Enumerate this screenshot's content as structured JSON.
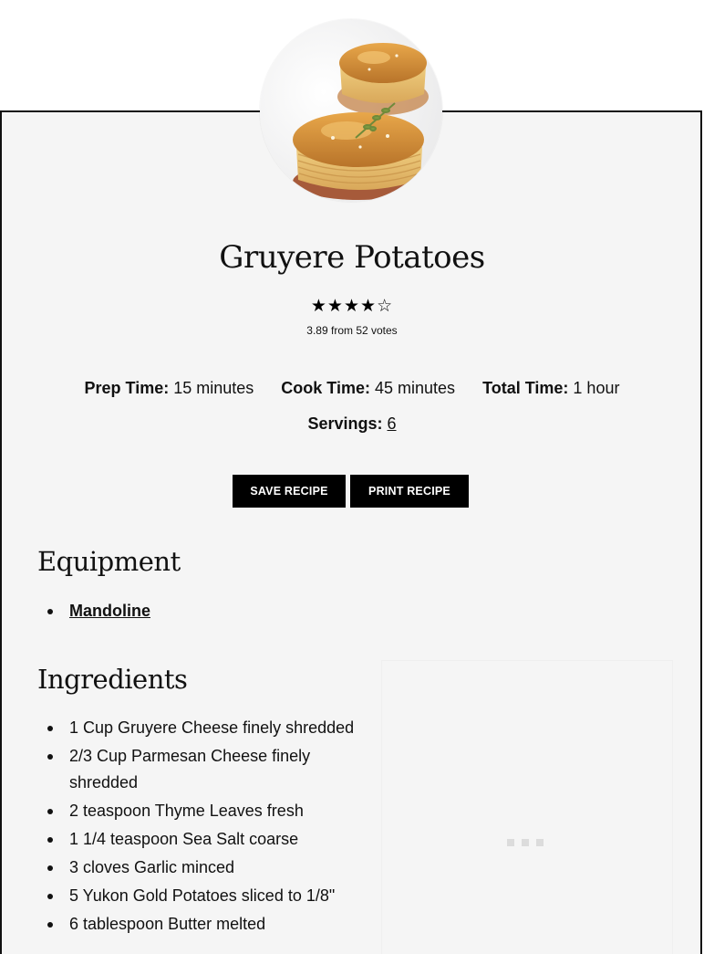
{
  "recipe": {
    "title": "Gruyere Potatoes",
    "rating": {
      "value": 3.89,
      "stars_full": 4,
      "stars_total": 5,
      "text": "3.89 from 52 votes"
    },
    "times": {
      "prep_label": "Prep Time:",
      "prep_value": "15 minutes",
      "cook_label": "Cook Time:",
      "cook_value": "45 minutes",
      "total_label": "Total Time:",
      "total_value": "1 hour"
    },
    "servings": {
      "label": "Servings:",
      "value": "6"
    },
    "buttons": {
      "save": "SAVE RECIPE",
      "print": "PRINT RECIPE"
    },
    "equipment": {
      "heading": "Equipment",
      "items": [
        "Mandoline"
      ]
    },
    "ingredients": {
      "heading": "Ingredients",
      "items": [
        "1 Cup Gruyere Cheese finely shredded",
        "2/3 Cup Parmesan Cheese finely shredded",
        "2 teaspoon Thyme Leaves fresh",
        "1 1/4 teaspoon Sea Salt coarse",
        "3 cloves Garlic minced",
        "5 Yukon Gold Potatoes  sliced to 1/8\"",
        "6 tablespoon Butter melted"
      ]
    },
    "image": {
      "icon": "potato-stack-photo"
    }
  },
  "colors": {
    "card_bg": "#f5f5f5",
    "button_bg": "#000000",
    "button_text": "#ffffff",
    "border": "#111111"
  }
}
